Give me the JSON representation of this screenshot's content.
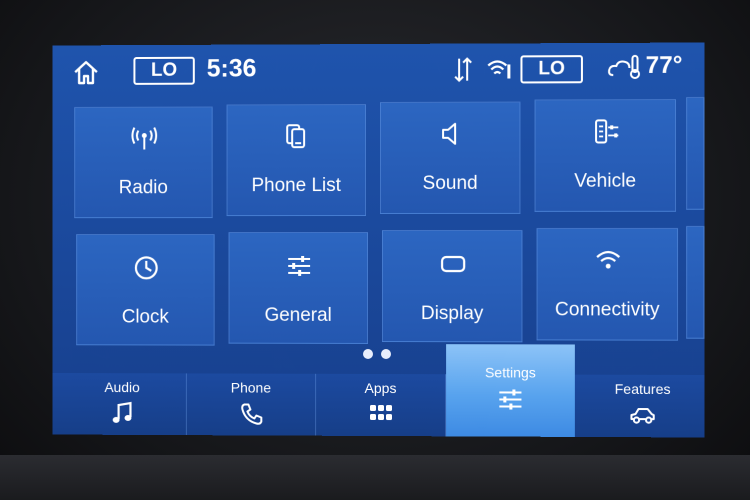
{
  "status_bar": {
    "left_climate": "LO",
    "time": "5:36",
    "right_climate": "LO",
    "temperature": "77°",
    "icons": [
      "home-icon",
      "signal-icon",
      "wifi-icon",
      "weather-icon"
    ]
  },
  "tiles": [
    {
      "label": "Radio",
      "icon": "radio-icon"
    },
    {
      "label": "Phone List",
      "icon": "phone-list-icon"
    },
    {
      "label": "Sound",
      "icon": "sound-icon"
    },
    {
      "label": "Vehicle",
      "icon": "vehicle-icon"
    },
    {
      "label": "Clock",
      "icon": "clock-icon"
    },
    {
      "label": "General",
      "icon": "sliders-icon"
    },
    {
      "label": "Display",
      "icon": "display-icon"
    },
    {
      "label": "Connectivity",
      "icon": "wifi-icon"
    }
  ],
  "pagination": {
    "pages": 2,
    "current": 1
  },
  "nav": [
    {
      "label": "Audio",
      "icon": "music-icon"
    },
    {
      "label": "Phone",
      "icon": "phone-icon"
    },
    {
      "label": "Apps",
      "icon": "apps-grid-icon"
    },
    {
      "label": "Settings",
      "icon": "settings-sliders-icon",
      "active": true
    },
    {
      "label": "Features",
      "icon": "car-icon"
    }
  ],
  "colors": {
    "screen": "#1f54ad",
    "tile": "#2c66c1",
    "active_tab": "#58a3ee"
  }
}
